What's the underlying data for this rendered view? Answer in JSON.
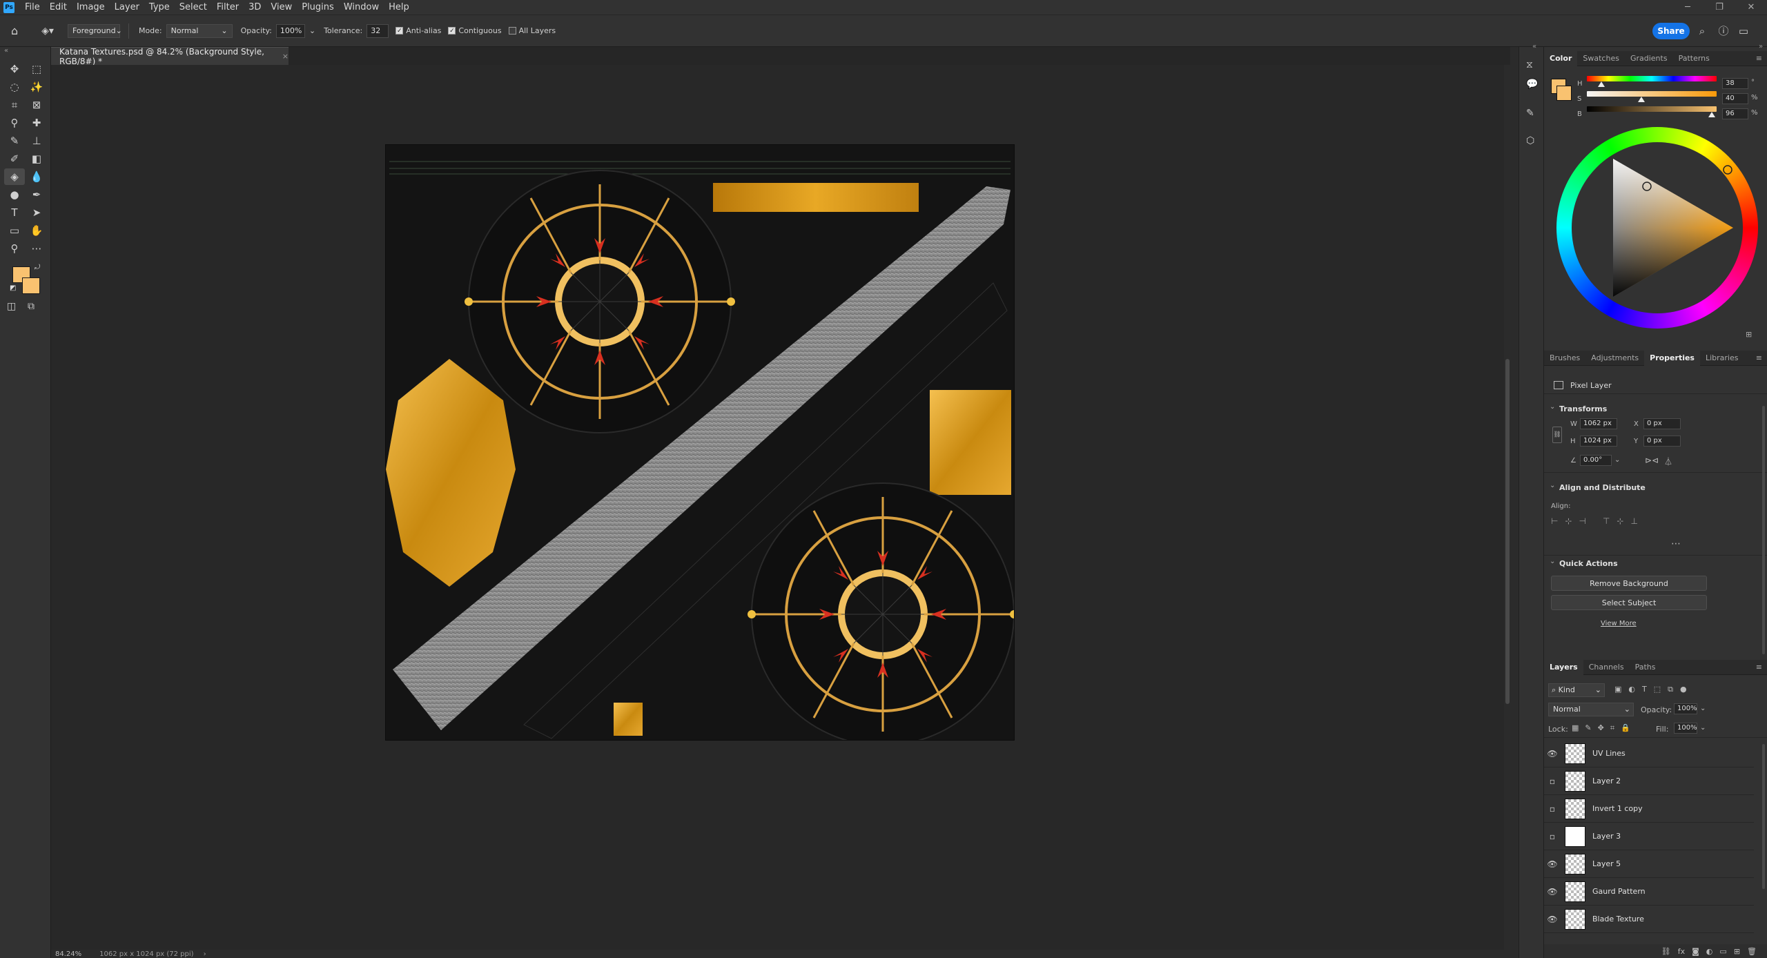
{
  "app": {
    "logo_text": "Ps"
  },
  "menu": [
    "File",
    "Edit",
    "Image",
    "Layer",
    "Type",
    "Select",
    "Filter",
    "3D",
    "View",
    "Plugins",
    "Window",
    "Help"
  ],
  "options_bar": {
    "fill_source": "Foreground",
    "mode_label": "Mode:",
    "mode_value": "Normal",
    "opacity_label": "Opacity:",
    "opacity_value": "100%",
    "tolerance_label": "Tolerance:",
    "tolerance_value": "32",
    "anti_alias_label": "Anti-alias",
    "contiguous_label": "Contiguous",
    "all_layers_label": "All Layers",
    "share_label": "Share"
  },
  "document_tab": {
    "title": "Katana Textures.psd @ 84.2% (Background Style, RGB/8#) *",
    "close": "×"
  },
  "status": {
    "zoom": "84.24%",
    "doc_size": "1062 px x 1024 px (72 ppi)"
  },
  "color_panel": {
    "tabs": [
      "Color",
      "Swatches",
      "Gradients",
      "Patterns"
    ],
    "active_tab": "Color",
    "h_label": "H",
    "h_value": "38",
    "s_label": "S",
    "s_value": "40",
    "b_label": "B",
    "b_value": "96",
    "unit_deg": "°",
    "unit_pct": "%",
    "foreground_color": "#f9c270"
  },
  "properties_panel": {
    "tabs": [
      "Brushes",
      "Adjustments",
      "Properties",
      "Libraries"
    ],
    "active_tab": "Properties",
    "layer_type": "Pixel Layer",
    "transforms_title": "Transforms",
    "w_label": "W",
    "w_value": "1062 px",
    "h_label": "H",
    "h_value": "1024 px",
    "x_label": "X",
    "x_value": "0 px",
    "y_label": "Y",
    "y_value": "0 px",
    "angle_value": "0.00°",
    "align_title": "Align and Distribute",
    "align_label": "Align:",
    "quick_actions_title": "Quick Actions",
    "remove_bg_label": "Remove Background",
    "select_subject_label": "Select Subject",
    "view_more_label": "View More"
  },
  "layers_panel": {
    "tabs": [
      "Layers",
      "Channels",
      "Paths"
    ],
    "active_tab": "Layers",
    "kind_label": "Kind",
    "blend_mode": "Normal",
    "opacity_label": "Opacity:",
    "opacity_value": "100%",
    "lock_label": "Lock:",
    "fill_label": "Fill:",
    "fill_value": "100%",
    "layers": [
      {
        "name": "UV Lines",
        "visible": true
      },
      {
        "name": "Layer 2",
        "visible": false
      },
      {
        "name": "Invert 1 copy",
        "visible": false
      },
      {
        "name": "Layer 3",
        "visible": false
      },
      {
        "name": "Layer 5",
        "visible": true
      },
      {
        "name": "Gaurd Pattern",
        "visible": true
      },
      {
        "name": "Blade Texture",
        "visible": true
      }
    ]
  }
}
